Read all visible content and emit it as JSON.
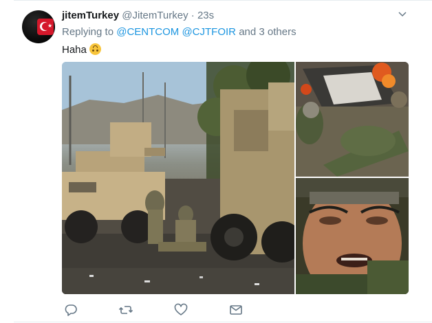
{
  "tweet": {
    "name": "jitemTurkey",
    "handle": "@JitemTurkey",
    "separator": "·",
    "time": "23s",
    "reply_prefix": "Replying to",
    "reply_mention_1": "@CENTCOM",
    "reply_mention_2": "@CJTFOIR",
    "reply_suffix": "and 3 others",
    "text": "Haha",
    "emoji": "upside-down-face"
  },
  "media": {
    "photos": [
      {
        "subject": "armored vehicles and soldiers at blast scene"
      },
      {
        "subject": "burning vehicle wreck and casualty"
      },
      {
        "subject": "crying soldier close-up"
      }
    ]
  },
  "actions": {
    "icons": [
      "reply-icon",
      "retweet-icon",
      "like-icon",
      "direct-message-icon"
    ]
  },
  "colors": {
    "link": "#1b95e0",
    "secondary_text": "#657786",
    "primary_text": "#14171a",
    "border": "#e6ecf0"
  }
}
